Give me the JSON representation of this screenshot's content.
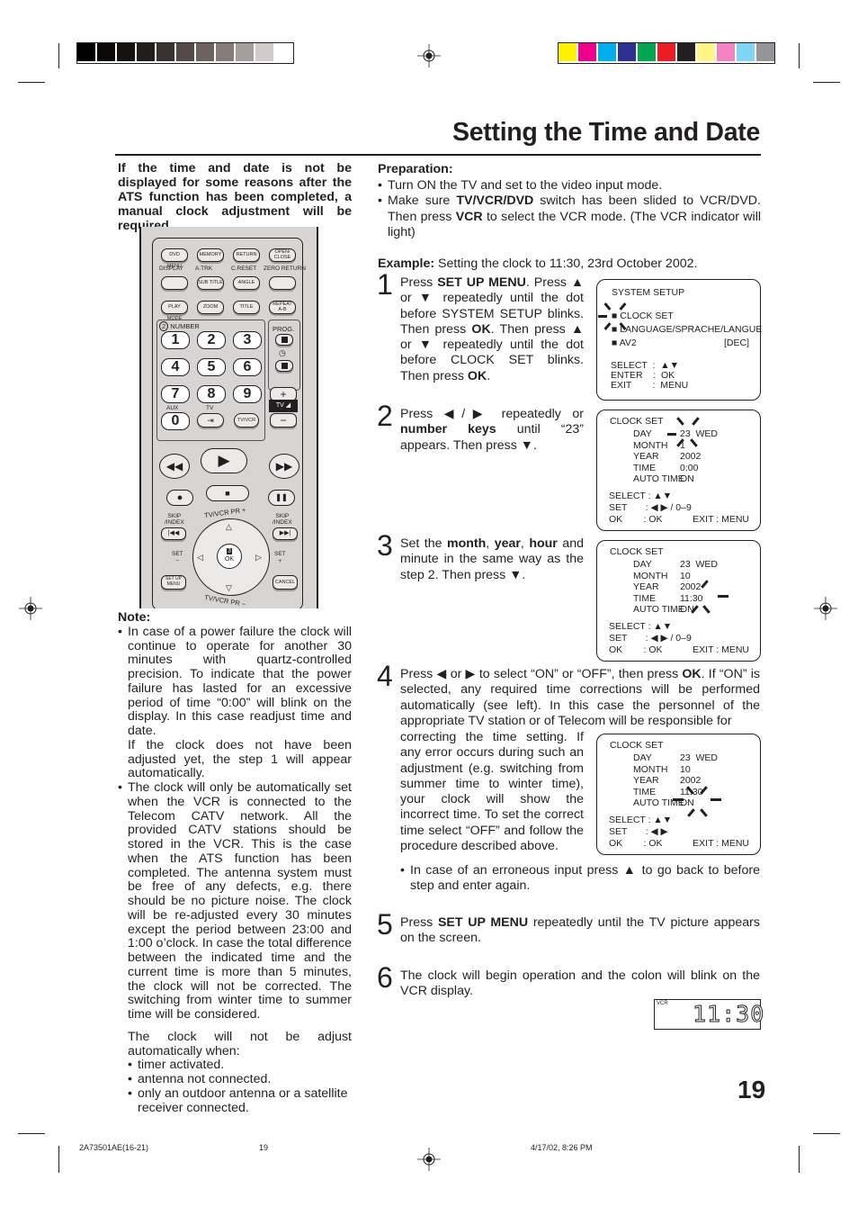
{
  "calibration": {
    "gray_swatches": [
      "#000000",
      "#0a0908",
      "#151210",
      "#221e1c",
      "#3a3230",
      "#544a47",
      "#6d625e",
      "#857b78",
      "#a69e9b",
      "#d2cbca",
      "#ffffff"
    ],
    "color_swatches": [
      "#fff200",
      "#ec008c",
      "#00aeef",
      "#2e3192",
      "#00a651",
      "#ed1c24",
      "#231f20",
      "#fff685",
      "#f583c4",
      "#7dd6f7",
      "#939598"
    ]
  },
  "title": "Setting the Time and Date",
  "intro": "If the time and date is not be displayed for some reasons after the ATS function has been completed, a manual clock adjustment will be required.",
  "preparation": {
    "heading": "Preparation:",
    "bullets": [
      {
        "parts": [
          {
            "t": "Turn ON the TV and set to the video input mode.",
            "b": false
          }
        ]
      },
      {
        "parts": [
          {
            "t": "Make sure ",
            "b": false
          },
          {
            "t": "TV/VCR/DVD",
            "b": true
          },
          {
            "t": " switch has been slided to VCR/DVD. Then press ",
            "b": false
          },
          {
            "t": "VCR",
            "b": true
          },
          {
            "t": " to select the VCR mode. (The VCR indicator will light)",
            "b": false
          }
        ]
      }
    ],
    "example_label": "Example:",
    "example_text": " Setting the clock to 11:30, 23rd October 2002."
  },
  "remote": {
    "row1": [
      "DVD MENU",
      "MEMORY",
      "RETURN",
      "OPEN/ CLOSE"
    ],
    "row2_labels": [
      "DISPLAY",
      "A.TRK",
      "C.RESET",
      "ZERO RETURN"
    ],
    "row2": [
      "",
      "SUB TITLE",
      "ANGLE",
      ""
    ],
    "row3": [
      "PLAY MODE",
      "ZOOM",
      "TITLE",
      "REPEAT A-B"
    ],
    "number_label": "NUMBER",
    "number_badge": "2",
    "prog_label": "PROG.",
    "keys": [
      "1",
      "2",
      "3",
      "4",
      "5",
      "6",
      "7",
      "8",
      "9"
    ],
    "aux_label": "AUX",
    "zero_key": "0",
    "tv_label": "TV",
    "tvvcr": "TV/VCR",
    "tv_vol_label": "TV",
    "plus": "+",
    "minus": "−",
    "skip_index": "SKIP /INDEX",
    "set_minus": "SET −",
    "set_plus": "SET +",
    "set_up_menu": "SET UP MENU",
    "cancel": "CANCEL",
    "ok": "OK",
    "ok_badge": "3",
    "tvvcr_pr_plus": "TV/VCR PR +",
    "tvvcr_pr_minus": "TV/VCR PR −"
  },
  "note": {
    "heading": "Note:",
    "bullet1": "In case of a power failure the clock will continue to operate for another 30 minutes with quartz-controlled precision. To indicate that the power failure has lasted for an excessive period of time “0:00” will blink on the display. In this case readjust time and date.",
    "bullet1_cont": "If the clock does not have been adjusted yet, the step 1 will appear automatically.",
    "bullet2": "The clock will only be automatically set when the VCR is connected to the Telecom CATV network. All the provided CATV stations should be stored in the VCR. This is the case when the ATS function has been completed. The antenna system must be free of any defects, e.g. there should be no picture noise. The clock will be re-adjusted every 30 minutes except the period between 23:00 and 1:00 o’clock. In case the total difference between the indicated time and the current time is more than 5 minutes, the clock will not be corrected. The switching from winter time to summer time will be considered.",
    "para": "The clock will not be adjust automatically when:",
    "list": [
      "timer activated.",
      "antenna not connected.",
      "only an outdoor antenna or a satellite receiver connected."
    ]
  },
  "steps": [
    {
      "num": "1",
      "html_parts": [
        {
          "t": "Press ",
          "b": false
        },
        {
          "t": "SET UP MENU",
          "b": true
        },
        {
          "t": ". Press ▲ or ▼ repeatedly until the dot before SYSTEM SETUP blinks. Then press ",
          "b": false
        },
        {
          "t": "OK",
          "b": true
        },
        {
          "t": ". Then press ▲ or ▼ repeatedly until the dot before CLOCK SET blinks. Then press ",
          "b": false
        },
        {
          "t": "OK",
          "b": true
        },
        {
          "t": ".",
          "b": false
        }
      ]
    },
    {
      "num": "2",
      "html_parts": [
        {
          "t": "Press ◀/▶ repeatedly or ",
          "b": false
        },
        {
          "t": "number keys",
          "b": true
        },
        {
          "t": " until “23” appears. Then press ▼.",
          "b": false
        }
      ]
    },
    {
      "num": "3",
      "html_parts": [
        {
          "t": "Set the ",
          "b": false
        },
        {
          "t": "month",
          "b": true
        },
        {
          "t": ", ",
          "b": false
        },
        {
          "t": "year",
          "b": true
        },
        {
          "t": ", ",
          "b": false
        },
        {
          "t": "hour",
          "b": true
        },
        {
          "t": " and minute in the same way as the step 2. Then press ▼.",
          "b": false
        }
      ]
    },
    {
      "num": "4",
      "html_parts": [
        {
          "t": "Press ◀ or ▶ to select “ON” or “OFF”, then press ",
          "b": false
        },
        {
          "t": "OK",
          "b": true
        },
        {
          "t": ". If “ON” is selected, any required time corrections will be performed automatically (see left). In this case the personnel of the appropriate TV station or of Telecom will be responsible for",
          "b": false
        }
      ],
      "cont": "correcting the time setting. If any error occurs during such an adjustment (e.g. switching from summer time to winter time), your clock will show the incorrect time. To set the correct time select “OFF” and follow the procedure described above.",
      "bullet": "In case of an erroneous input press ▲ to go back to before step and enter again."
    },
    {
      "num": "5",
      "html_parts": [
        {
          "t": "Press ",
          "b": false
        },
        {
          "t": "SET UP MENU",
          "b": true
        },
        {
          "t": " repeatedly until the TV picture appears on the screen.",
          "b": false
        }
      ]
    },
    {
      "num": "6",
      "html_parts": [
        {
          "t": "The clock will begin operation and the colon will blink on the VCR display.",
          "b": false
        }
      ]
    }
  ],
  "osd1": {
    "title": "SYSTEM SETUP",
    "items": [
      "CLOCK SET",
      "LANGUAGE/SPRACHE/LANGUE",
      "AV2"
    ],
    "av2_value": "[DEC]",
    "footer": [
      [
        "SELECT",
        ":  ▲▼"
      ],
      [
        "ENTER",
        ":  OK"
      ],
      [
        "EXIT",
        ":  MENU"
      ]
    ]
  },
  "osd_clock": [
    {
      "title": "CLOCK SET",
      "rows": [
        [
          "DAY",
          "23  WED"
        ],
        [
          "MONTH",
          "1"
        ],
        [
          "YEAR",
          "2002"
        ],
        [
          "TIME",
          "0:00"
        ],
        [
          "AUTO TIME",
          "ON"
        ]
      ],
      "select": "SELECT : ▲▼",
      "set": "SET       : ◀ ▶ / 0–9",
      "ok": "OK        : OK",
      "exit": "EXIT : MENU"
    },
    {
      "title": "CLOCK SET",
      "rows": [
        [
          "DAY",
          "23  WED"
        ],
        [
          "MONTH",
          "10"
        ],
        [
          "YEAR",
          "2002"
        ],
        [
          "TIME",
          "11:30"
        ],
        [
          "AUTO TIME",
          "ON"
        ]
      ],
      "select": "SELECT : ▲▼",
      "set": "SET       : ◀ ▶ / 0–9",
      "ok": "OK        : OK",
      "exit": "EXIT : MENU"
    },
    {
      "title": "CLOCK SET",
      "rows": [
        [
          "DAY",
          "23  WED"
        ],
        [
          "MONTH",
          "10"
        ],
        [
          "YEAR",
          "2002"
        ],
        [
          "TIME",
          "11:30"
        ],
        [
          "AUTO TIME",
          "ON"
        ]
      ],
      "select": "SELECT : ▲▼",
      "set": "SET       : ◀ ▶",
      "ok": "OK        : OK",
      "exit": "EXIT : MENU"
    }
  ],
  "vcr_display": {
    "label": "VCR",
    "time": "11:30"
  },
  "page_number": "19",
  "footer": {
    "code": "2A73501AE(16-21)",
    "page": "19",
    "date": "4/17/02, 8:26 PM"
  }
}
